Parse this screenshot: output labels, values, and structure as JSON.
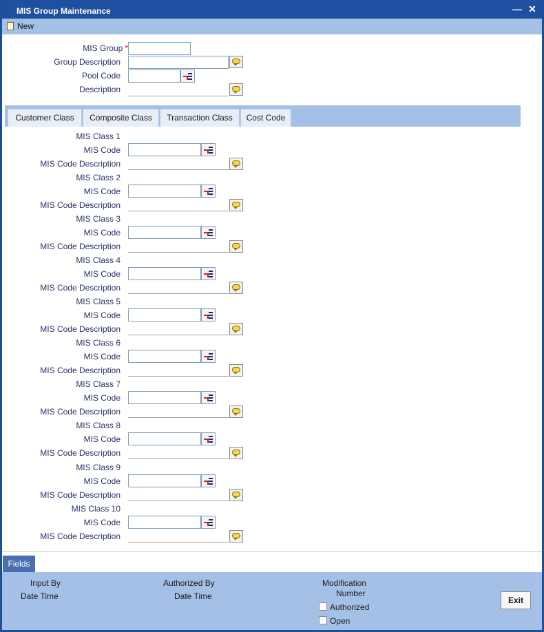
{
  "window": {
    "title": "MIS Group Maintenance",
    "minimize_icon": "minimize-icon",
    "close_icon": "close-icon"
  },
  "toolbar": {
    "new_label": "New",
    "new_icon": "new-document-icon"
  },
  "header": {
    "mis_group_label": "MIS Group",
    "required_mark": "*",
    "mis_group_value": "",
    "group_description_label": "Group Description",
    "group_description_value": "",
    "pool_code_label": "Pool Code",
    "pool_code_value": "",
    "description_label": "Description",
    "description_value": ""
  },
  "tabs": [
    {
      "label": "Customer Class"
    },
    {
      "label": "Composite Class"
    },
    {
      "label": "Transaction Class"
    },
    {
      "label": "Cost Code"
    }
  ],
  "mis_classes": [
    {
      "class_label": "MIS Class 1",
      "code_label": "MIS Code",
      "desc_label": "MIS Code Description",
      "code_value": "",
      "desc_value": ""
    },
    {
      "class_label": "MIS Class 2",
      "code_label": "MIS Code",
      "desc_label": "MIS Code Description",
      "code_value": "",
      "desc_value": ""
    },
    {
      "class_label": "MIS Class 3",
      "code_label": "MIS Code",
      "desc_label": "MIS Code Description",
      "code_value": "",
      "desc_value": ""
    },
    {
      "class_label": "MIS Class 4",
      "code_label": "MIS Code",
      "desc_label": "MIS Code Description",
      "code_value": "",
      "desc_value": ""
    },
    {
      "class_label": "MIS Class 5",
      "code_label": "MIS Code",
      "desc_label": "MIS Code Description",
      "code_value": "",
      "desc_value": ""
    },
    {
      "class_label": "MIS Class 6",
      "code_label": "MIS Code",
      "desc_label": "MIS Code Description",
      "code_value": "",
      "desc_value": ""
    },
    {
      "class_label": "MIS Class 7",
      "code_label": "MIS Code",
      "desc_label": "MIS Code Description",
      "code_value": "",
      "desc_value": ""
    },
    {
      "class_label": "MIS Class 8",
      "code_label": "MIS Code",
      "desc_label": "MIS Code Description",
      "code_value": "",
      "desc_value": ""
    },
    {
      "class_label": "MIS Class 9",
      "code_label": "MIS Code",
      "desc_label": "MIS Code Description",
      "code_value": "",
      "desc_value": ""
    },
    {
      "class_label": "MIS Class 10",
      "code_label": "MIS Code",
      "desc_label": "MIS Code Description",
      "code_value": "",
      "desc_value": ""
    }
  ],
  "fields_tab": {
    "label": "Fields"
  },
  "footer": {
    "input_by_label": "Input By",
    "date_time_label": "Date Time",
    "authorized_by_label": "Authorized By",
    "auth_date_time_label": "Date Time",
    "modification_label": "Modification",
    "number_label": "Number",
    "authorized_label": "Authorized",
    "open_label": "Open",
    "exit_label": "Exit"
  }
}
